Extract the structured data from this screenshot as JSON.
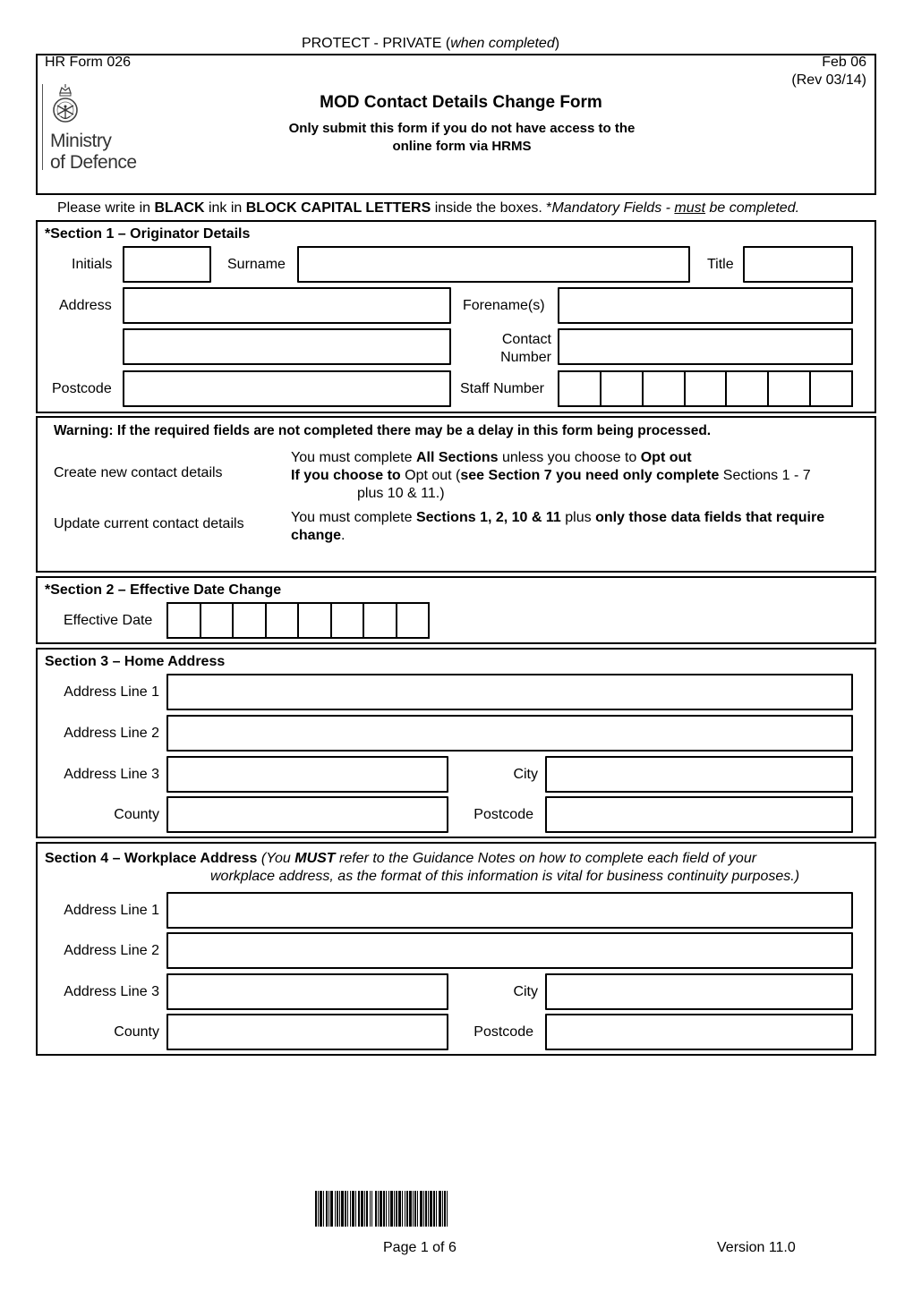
{
  "header": {
    "classification": "PROTECT - PRIVATE",
    "classification_note": "when completed",
    "form_number": "HR Form 026",
    "date": "Feb 06",
    "revision": "(Rev 03/14)",
    "logo_line1": "Ministry",
    "logo_line2": "of Defence",
    "title": "MOD Contact Details Change Form",
    "subtitle_line1": "Only submit this form if you do not have access to the",
    "subtitle_line2": "online form via HRMS"
  },
  "instructions": {
    "part1": "Please write in ",
    "black": "BLACK",
    "part2": " ink in ",
    "block_caps": "BLOCK CAPITAL LETTERS",
    "part3": " inside the boxes. *",
    "mandatory": "Mandatory Fields - ",
    "must": "must",
    "completed": " be completed."
  },
  "section1": {
    "title": "*Section 1 – Originator Details",
    "initials_label": "Initials",
    "surname_label": "Surname",
    "title_label": "Title",
    "address_label": "Address",
    "forenames_label": "Forename(s)",
    "contact_label_1": "Contact",
    "contact_label_2": "Number",
    "postcode_label": "Postcode",
    "staff_number_label": "Staff Number",
    "staff_number_cells": 7
  },
  "warning": {
    "heading": "Warning: If the required fields are not completed there may be a delay in this form being processed.",
    "create_label": "Create new contact details",
    "create_l1_a": "You must complete ",
    "create_l1_b": "All Sections",
    "create_l1_c": " unless you choose to ",
    "create_l1_d": "Opt out",
    "create_l2_a": "If you choose to",
    "create_l2_b": " Opt out (",
    "create_l2_c": "see Section 7 you need only complete",
    "create_l2_d": " Sections 1 - 7",
    "create_l3": "plus 10 & 11.)",
    "update_label": "Update current contact details",
    "update_l1_a": "You must complete ",
    "update_l1_b": "Sections 1, 2, 10 & 11",
    "update_l1_c": " plus ",
    "update_l1_d": "only those data fields that require",
    "update_l2_a": "change",
    "update_l2_b": "."
  },
  "section2": {
    "title": "*Section 2 – Effective Date Change",
    "effective_date_label": "Effective Date",
    "date_cells": 8
  },
  "section3": {
    "title": "Section 3 – Home Address",
    "line1_label": "Address Line 1",
    "line2_label": "Address Line 2",
    "line3_label": "Address Line 3",
    "city_label": "City",
    "county_label": "County",
    "postcode_label": "Postcode"
  },
  "section4": {
    "title_bold": "Section 4 – Workplace Address",
    "note_a": " (You ",
    "note_must": "MUST",
    "note_b": " refer to the Guidance Notes on how to complete each field of your",
    "note_line2": "workplace address, as the format of this information is vital for business continuity purposes.)",
    "line1_label": "Address Line 1",
    "line2_label": "Address Line 2",
    "line3_label": "Address Line 3",
    "city_label": "City",
    "county_label": "County",
    "postcode_label": "Postcode"
  },
  "footer": {
    "page": "Page 1 of 6",
    "version": "Version 11.0"
  }
}
